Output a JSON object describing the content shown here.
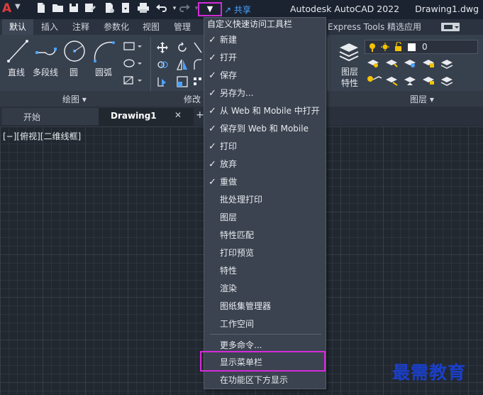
{
  "app": {
    "title": "Autodesk AutoCAD 2022",
    "document": "Drawing1.dwg",
    "logo": "A",
    "share_label": "共享"
  },
  "ribbon_tabs": [
    "默认",
    "插入",
    "注释",
    "参数化",
    "视图",
    "管理",
    "Express Tools",
    "精选应用"
  ],
  "draw_panel": {
    "tools": [
      "直线",
      "多段线",
      "圆",
      "圆弧"
    ],
    "title": "绘图 ▾"
  },
  "modify_panel": {
    "title": "修改"
  },
  "layers_panel": {
    "layer_properties": "图层\n特性",
    "layer_properties_line1": "图层",
    "layer_properties_line2": "特性",
    "current_layer": "0",
    "title": "图层 ▾"
  },
  "file_tabs": {
    "start": "开始",
    "drawing": "Drawing1",
    "close": "✕"
  },
  "viewport": {
    "label": "[−][俯视][二维线框]"
  },
  "menu": {
    "title": "自定义快速访问工具栏",
    "items": [
      {
        "label": "新建",
        "checked": true
      },
      {
        "label": "打开",
        "checked": true
      },
      {
        "label": "保存",
        "checked": true
      },
      {
        "label": "另存为...",
        "checked": true
      },
      {
        "label": "从 Web 和 Mobile 中打开",
        "checked": true
      },
      {
        "label": "保存到 Web 和 Mobile",
        "checked": true
      },
      {
        "label": "打印",
        "checked": true
      },
      {
        "label": "放弃",
        "checked": true
      },
      {
        "label": "重做",
        "checked": true
      },
      {
        "label": "批处理打印",
        "checked": false
      },
      {
        "label": "图层",
        "checked": false
      },
      {
        "label": "特性匹配",
        "checked": false
      },
      {
        "label": "打印预览",
        "checked": false
      },
      {
        "label": "特性",
        "checked": false
      },
      {
        "label": "渲染",
        "checked": false
      },
      {
        "label": "图纸集管理器",
        "checked": false
      },
      {
        "label": "工作空间",
        "checked": false
      }
    ],
    "more": "更多命令...",
    "show_menubar": "显示菜单栏",
    "show_below": "在功能区下方显示",
    "check_mark": "✓"
  },
  "watermark": "最需教育",
  "colors": {
    "highlight": "#d42bd8",
    "menu_bg": "#3b4350",
    "viewport_bg": "#212830",
    "accent_blue": "#4aa3ff"
  }
}
